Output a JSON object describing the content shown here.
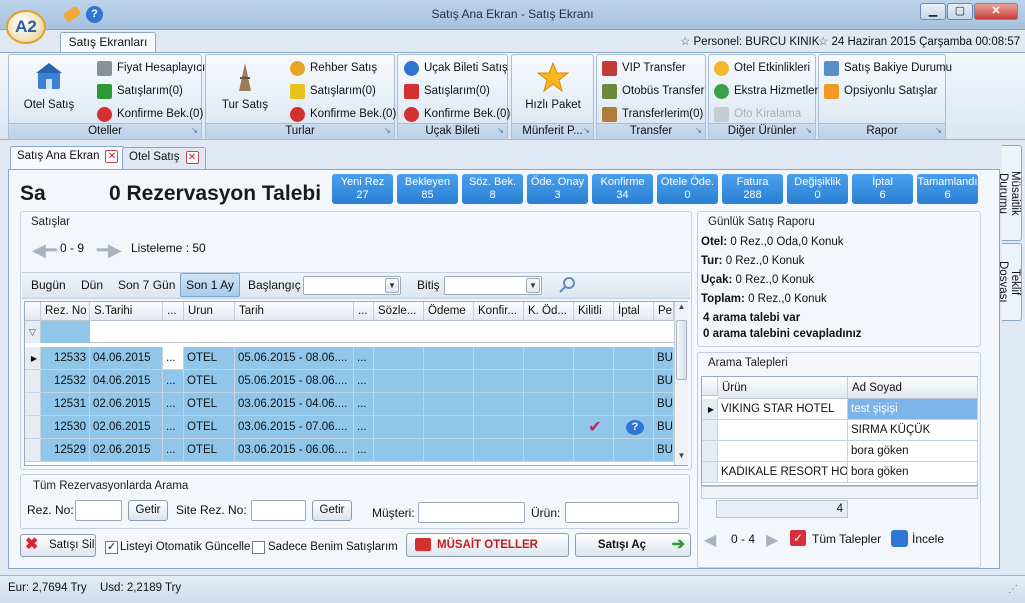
{
  "window": {
    "title": "Satış Ana Ekran - Satış Ekranı"
  },
  "logo": {
    "text": "A2"
  },
  "ribbon_tab": "Satış Ekranları",
  "status": {
    "personnel": "Personel: BURCU KINIK",
    "date": "24 Haziran 2015 Çarşamba 00:08:57"
  },
  "groups": {
    "oteller": {
      "label": "Oteller",
      "big": "Otel Satış",
      "items": [
        "Fiyat Hesaplayıcı",
        "Satışlarım(0)",
        "Konfirme Bek.(0)"
      ]
    },
    "turlar": {
      "label": "Turlar",
      "big": "Tur Satış",
      "items": [
        "Rehber Satış",
        "Satışlarım(0)",
        "Konfirme Bek.(0)"
      ]
    },
    "ucak": {
      "label": "Uçak Bileti",
      "items": [
        "Uçak Bileti Satış",
        "Satışlarım(0)",
        "Konfirme Bek.(0)"
      ]
    },
    "munferit": {
      "label": "Münferit P...",
      "big": "Hızlı Paket"
    },
    "transfer": {
      "label": "Transfer",
      "items": [
        "VIP Transfer",
        "Otobüs Transfer",
        "Transferlerim(0)"
      ]
    },
    "diger": {
      "label": "Diğer Ürünler",
      "items": [
        "Otel Etkinlikleri",
        "Ekstra Hizmetler",
        "Oto Kiralama"
      ]
    },
    "rapor": {
      "label": "Rapor",
      "items": [
        "Satış Bakiye Durumu",
        "Opsiyonlu Satışlar"
      ]
    }
  },
  "doc_tabs": [
    "Satış Ana Ekran",
    "Otel Satış"
  ],
  "side_tabs": [
    "Müsaitlik Durumu",
    "Teklif Dosyası"
  ],
  "heading": {
    "prefix": "Sa",
    "count_text": "0 Rezervasyon Talebi"
  },
  "stats": [
    {
      "label": "Yeni Rez",
      "value": "27"
    },
    {
      "label": "Bekleyen",
      "value": "85"
    },
    {
      "label": "Söz. Bek.",
      "value": "8"
    },
    {
      "label": "Öde. Onay",
      "value": "3"
    },
    {
      "label": "Konfirme",
      "value": "34"
    },
    {
      "label": "Otele Öde.",
      "value": "0"
    },
    {
      "label": "Fatura",
      "value": "288"
    },
    {
      "label": "Değişiklik",
      "value": "0"
    },
    {
      "label": "İptal",
      "value": "6"
    },
    {
      "label": "Tamamlandı",
      "value": "6"
    }
  ],
  "sales": {
    "title": "Satışlar",
    "range": "0 - 9",
    "listing": "Listeleme : 50",
    "filters": [
      "Bugün",
      "Dün",
      "Son 7 Gün",
      "Son 1 Ay"
    ],
    "start_label": "Başlangıç",
    "end_label": "Bitiş",
    "columns": [
      "Rez. No",
      "S.Tarihi",
      "...",
      "Urun",
      "Tarih",
      "...",
      "Sözle...",
      "Ödeme",
      "Konfir...",
      "K. Öd...",
      "Kilitli",
      "İptal",
      "Pe"
    ],
    "rows": [
      {
        "rez": "12533",
        "starihi": "04.06.2015",
        "dots": "...",
        "urun": "OTEL",
        "tarih": "05.06.2015 - 08.06....",
        "dots2": "...",
        "pe": "BUI"
      },
      {
        "rez": "12532",
        "starihi": "04.06.2015",
        "dots": "...",
        "urun": "OTEL",
        "tarih": "05.06.2015 - 08.06....",
        "dots2": "...",
        "pe": "BUI"
      },
      {
        "rez": "12531",
        "starihi": "02.06.2015",
        "dots": "...",
        "urun": "OTEL",
        "tarih": "03.06.2015 - 04.06....",
        "dots2": "...",
        "pe": "BUI"
      },
      {
        "rez": "12530",
        "starihi": "02.06.2015",
        "dots": "...",
        "urun": "OTEL",
        "tarih": "03.06.2015 - 07.06....",
        "dots2": "...",
        "pe": "BUI"
      },
      {
        "rez": "12529",
        "starihi": "02.06.2015",
        "dots": "...",
        "urun": "OTEL",
        "tarih": "03.06.2015 - 06.06....",
        "dots2": "...",
        "pe": "BUI"
      }
    ]
  },
  "search": {
    "title": "Tüm Rezervasyonlarda Arama",
    "rez_label": "Rez. No:",
    "site_label": "Site Rez. No:",
    "get": "Getir",
    "musteri_label": "Müşteri:",
    "urun_label": "Ürün:"
  },
  "bottom": {
    "delete": "Satışı Sil",
    "auto_update": "Listeyi Otomatik Güncelle",
    "only_mine": "Sadece Benim Satışlarım",
    "musait": "MÜSAİT OTELLER",
    "open": "Satışı Aç"
  },
  "report": {
    "title": "Günlük Satış Raporu",
    "lines": [
      {
        "label": "Otel:",
        "value": "0 Rez.,0 Oda,0 Konuk"
      },
      {
        "label": "Tur:",
        "value": "0 Rez.,0 Konuk"
      },
      {
        "label": "Uçak:",
        "value": "0 Rez.,0 Konuk"
      },
      {
        "label": "Toplam:",
        "value": "0 Rez.,0 Konuk"
      }
    ],
    "note1": "4 arama talebi var",
    "note2": "0 arama talebini cevapladınız"
  },
  "requests": {
    "title": "Arama Talepleri",
    "columns": [
      "Ürün",
      "Ad Soyad"
    ],
    "rows": [
      {
        "urun": "VIKING STAR HOTEL",
        "ad": "test şişişi"
      },
      {
        "urun": "",
        "ad": "SIRMA KÜÇÜK"
      },
      {
        "urun": "",
        "ad": "bora göken"
      },
      {
        "urun": "KADIKALE RESORT HO...",
        "ad": "bora göken"
      }
    ],
    "count": "4",
    "range": "0 - 4",
    "all": "Tüm Talepler",
    "inspect": "İncele"
  },
  "footer": {
    "eur": "Eur: 2,7694 Try",
    "usd": "Usd: 2,2189 Try"
  }
}
